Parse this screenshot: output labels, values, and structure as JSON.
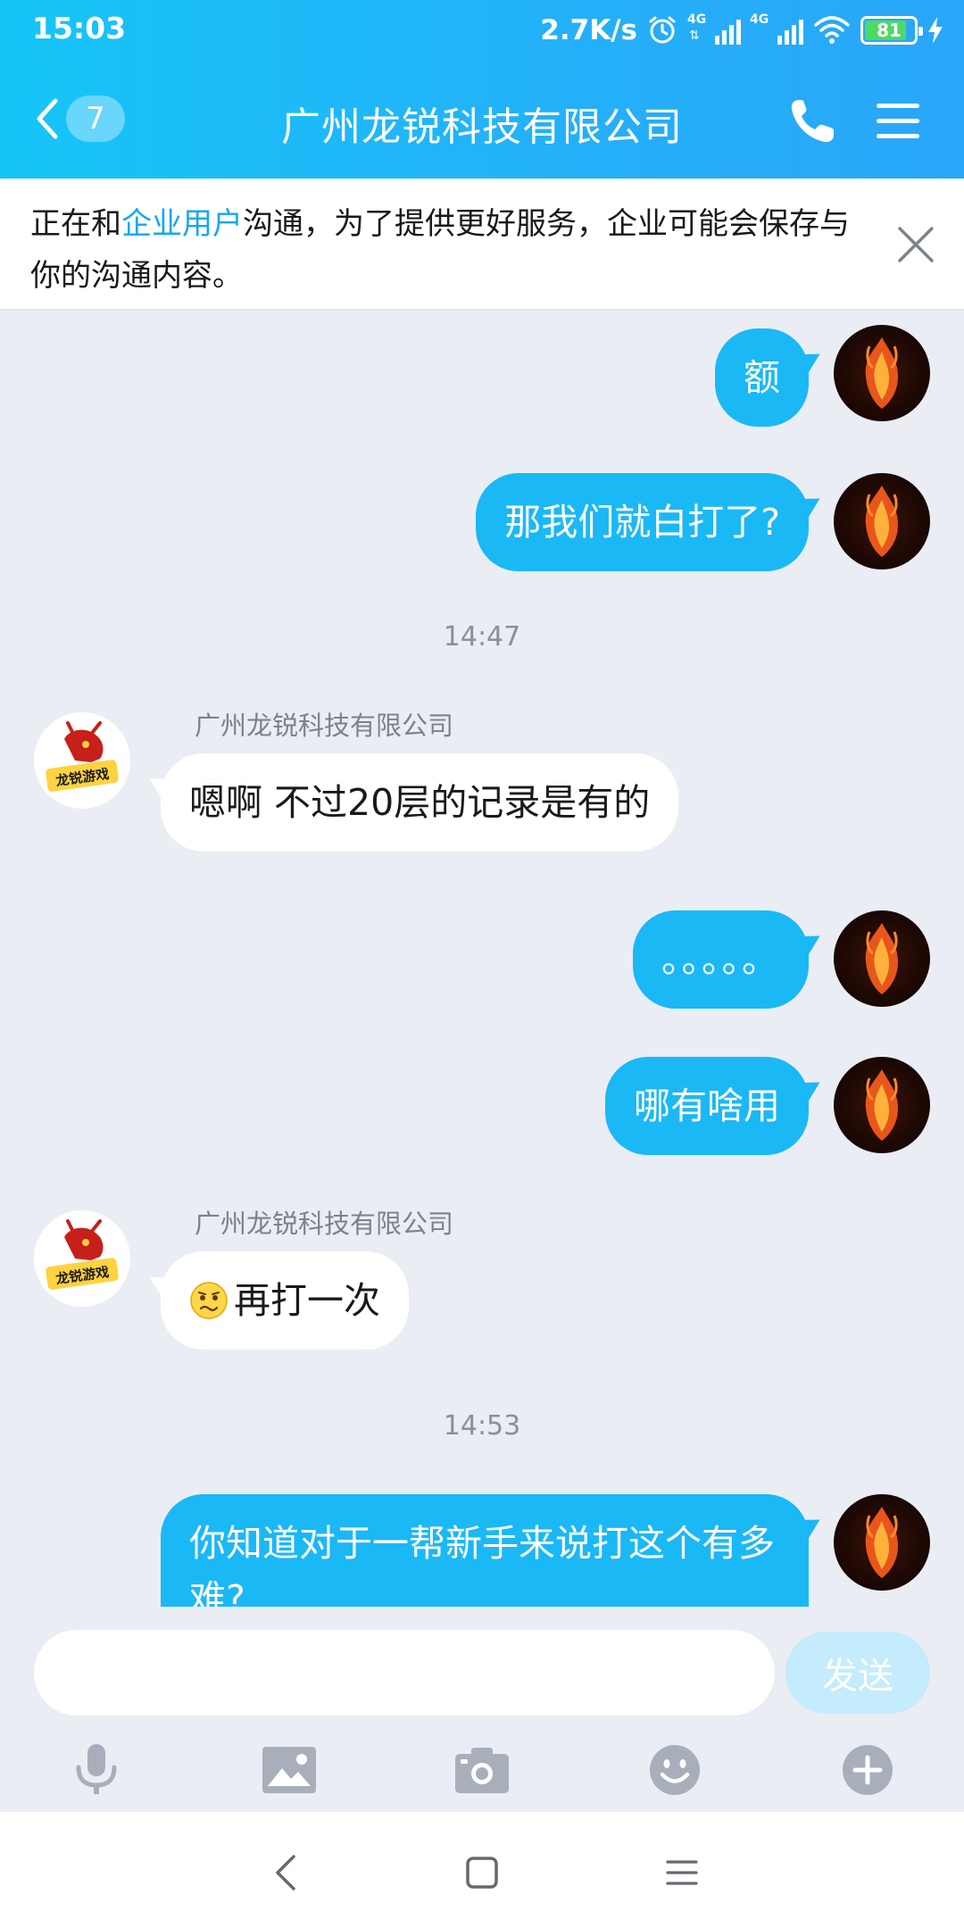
{
  "status_bar": {
    "time": "15:03",
    "net_speed": "2.7K/s",
    "sim1_tag": "4G",
    "sim2_tag": "4G",
    "battery": "81",
    "icons": [
      "alarm-icon",
      "signal-icon",
      "wifi-icon",
      "battery-icon",
      "charging-icon"
    ]
  },
  "header": {
    "back_count": "7",
    "title": "广州龙锐科技有限公司",
    "icons": [
      "back-chevron-icon",
      "phone-icon",
      "menu-icon"
    ]
  },
  "notice": {
    "prefix": "正在和",
    "highlight": "企业用户",
    "suffix": "沟通，为了提供更好服务，企业可能会保存与你的沟通内容。"
  },
  "messages": [
    {
      "side": "me",
      "text": "额"
    },
    {
      "side": "me",
      "text": "那我们就白打了?"
    },
    {
      "type": "time",
      "text": "14:47"
    },
    {
      "side": "them",
      "sender": "广州龙锐科技有限公司",
      "text": "嗯啊 不过20层的记录是有的"
    },
    {
      "side": "me",
      "text": "。。。。。"
    },
    {
      "side": "me",
      "text": "哪有啥用"
    },
    {
      "side": "them",
      "sender": "广州龙锐科技有限公司",
      "emoji": "confused-face-emoji",
      "text": "再打一次"
    },
    {
      "type": "time",
      "text": "14:53"
    },
    {
      "side": "me",
      "text": "你知道对于一帮新手来说打这个有多难?"
    }
  ],
  "input": {
    "value": "",
    "placeholder": "",
    "send_label": "发送"
  },
  "toolbar": [
    "microphone-icon",
    "image-icon",
    "camera-icon",
    "emoji-icon",
    "plus-icon"
  ],
  "nav": [
    "back-icon",
    "home-icon",
    "recents-icon"
  ],
  "colors": {
    "header_start": "#16c5f7",
    "header_end": "#29a6f8",
    "my_bubble": "#1bb8f6",
    "their_bubble": "#ffffff",
    "chat_bg": "#eaedf4",
    "notice_highlight": "#12a8ef",
    "send_disabled": "#c4ecfd"
  }
}
